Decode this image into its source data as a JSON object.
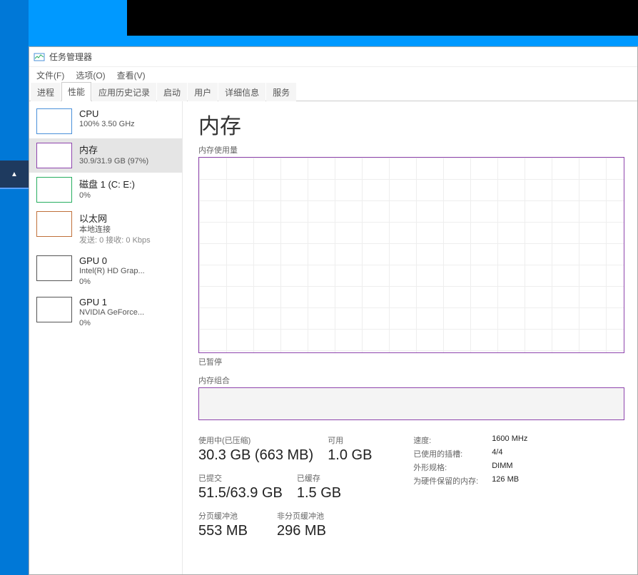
{
  "window": {
    "title": "任务管理器"
  },
  "menu": {
    "file": "文件(F)",
    "options": "选项(O)",
    "view": "查看(V)"
  },
  "tabs": {
    "processes": "进程",
    "performance": "性能",
    "app_history": "应用历史记录",
    "startup": "启动",
    "users": "用户",
    "details": "详细信息",
    "services": "服务"
  },
  "sidebar": {
    "cpu": {
      "title": "CPU",
      "sub": "100%  3.50 GHz"
    },
    "mem": {
      "title": "内存",
      "sub": "30.9/31.9 GB (97%)"
    },
    "disk": {
      "title": "磁盘 1 (C: E:)",
      "sub": "0%"
    },
    "eth": {
      "title": "以太网",
      "sub1": "本地连接",
      "sub2": "发送: 0 接收: 0 Kbps"
    },
    "gpu0": {
      "title": "GPU 0",
      "sub1": "Intel(R) HD Grap...",
      "sub2": "0%"
    },
    "gpu1": {
      "title": "GPU 1",
      "sub1": "NVIDIA GeForce...",
      "sub2": "0%"
    }
  },
  "main": {
    "title": "内存",
    "usage_label": "内存使用量",
    "paused": "已暂停",
    "composition_label": "内存组合",
    "stats": {
      "in_use_label": "使用中(已压缩)",
      "in_use_value": "30.3 GB (663 MB)",
      "available_label": "可用",
      "available_value": "1.0 GB",
      "committed_label": "已提交",
      "committed_value": "51.5/63.9 GB",
      "cached_label": "已缓存",
      "cached_value": "1.5 GB",
      "paged_label": "分页缓冲池",
      "paged_value": "553 MB",
      "nonpaged_label": "非分页缓冲池",
      "nonpaged_value": "296 MB"
    },
    "right": {
      "speed_k": "速度:",
      "speed_v": "1600 MHz",
      "slots_k": "已使用的插槽:",
      "slots_v": "4/4",
      "form_k": "外形规格:",
      "form_v": "DIMM",
      "reserved_k": "为硬件保留的内存:",
      "reserved_v": "126 MB"
    }
  }
}
